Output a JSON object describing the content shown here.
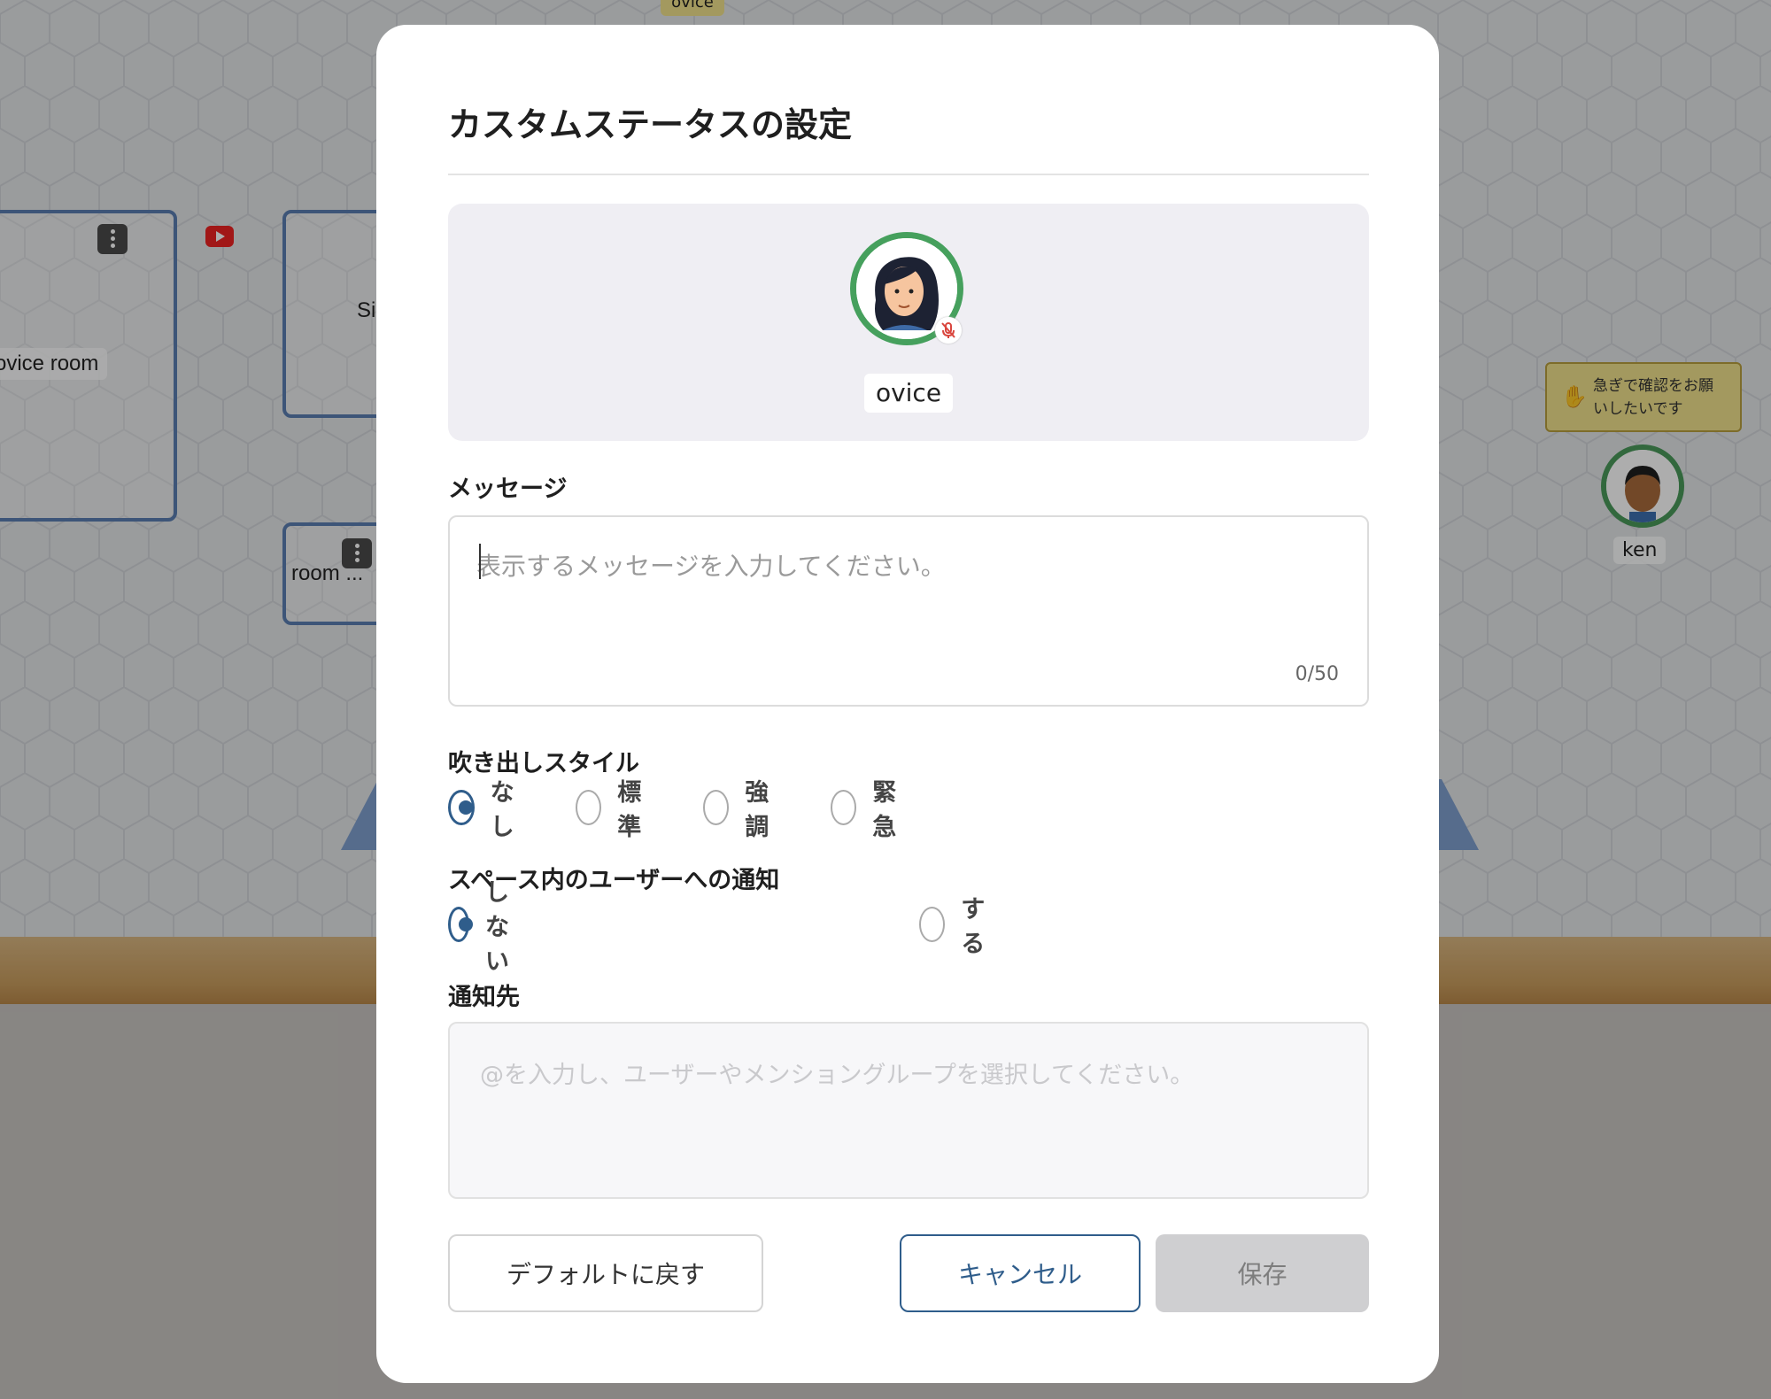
{
  "background": {
    "rooms": [
      {
        "label": "ovice room"
      },
      {
        "label": "Si"
      },
      {
        "label": "room ..."
      }
    ],
    "top_tag": "ovice",
    "status_bubble": "急ぎで確認をお願いしたいです",
    "other_user": {
      "name": "ken"
    }
  },
  "modal": {
    "title": "カスタムステータスの設定",
    "preview": {
      "user_name": "ovice",
      "avatar_ring_color": "#46a05d"
    },
    "message": {
      "label": "メッセージ",
      "placeholder": "表示するメッセージを入力してください。",
      "value": "",
      "counter": "0/50"
    },
    "bubble_style": {
      "label": "吹き出しスタイル",
      "options": [
        "なし",
        "標準",
        "強調",
        "緊急"
      ],
      "selected": "なし"
    },
    "notify": {
      "label": "スペース内のユーザーへの通知",
      "options": [
        "しない",
        "する"
      ],
      "selected": "しない"
    },
    "destination": {
      "label": "通知先",
      "placeholder": "@を入力し、ユーザーやメンショングループを選択してください。"
    },
    "buttons": {
      "reset": "デフォルトに戻す",
      "cancel": "キャンセル",
      "save": "保存"
    },
    "colors": {
      "accent": "#2f5d8b",
      "save_disabled": "#cfcfd1"
    }
  }
}
